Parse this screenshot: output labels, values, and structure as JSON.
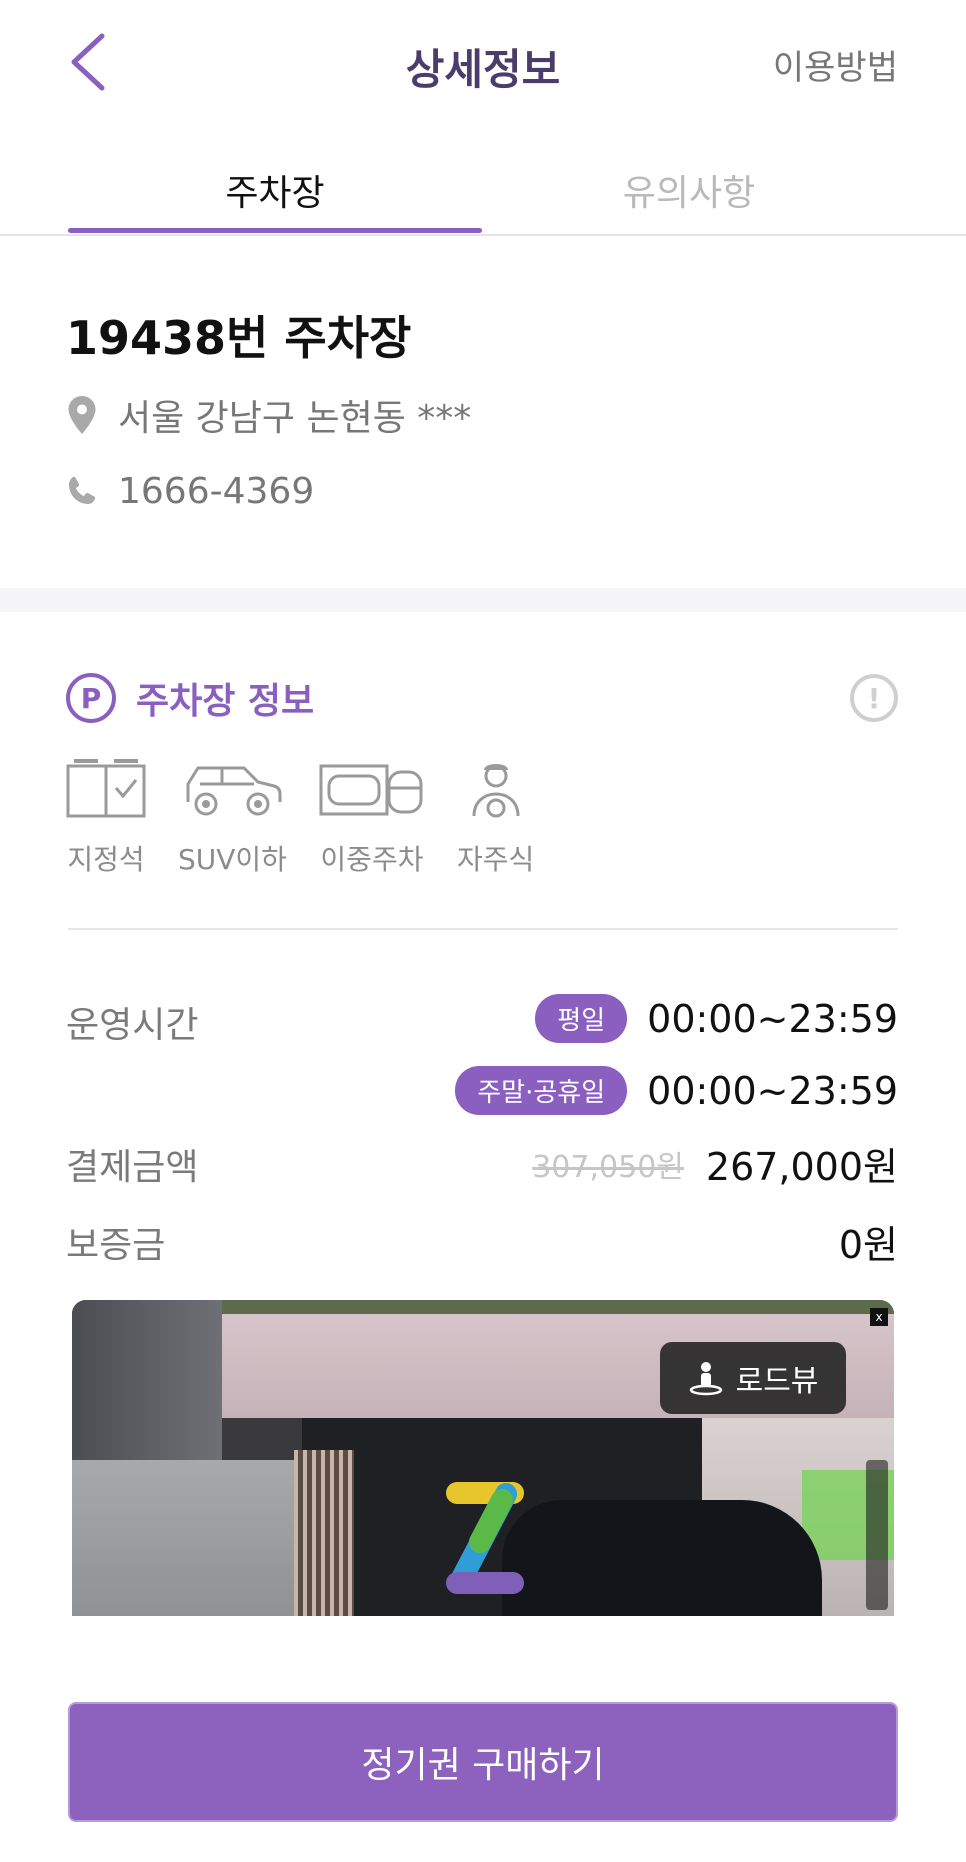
{
  "header": {
    "title": "상세정보",
    "help_label": "이용방법"
  },
  "tabs": [
    {
      "label": "주차장",
      "active": true
    },
    {
      "label": "유의사항",
      "active": false
    }
  ],
  "lot": {
    "name": "19438번 주차장",
    "address": "서울 강남구 논현동 ***",
    "phone": "1666-4369"
  },
  "section": {
    "title": "주차장 정보",
    "p_letter": "P",
    "warn_symbol": "!"
  },
  "features": [
    {
      "label": "지정석",
      "icon": "reserved-seat-icon"
    },
    {
      "label": "SUV이하",
      "icon": "suv-car-icon"
    },
    {
      "label": "이중주차",
      "icon": "double-parking-icon"
    },
    {
      "label": "자주식",
      "icon": "self-parking-icon"
    }
  ],
  "details": {
    "hours_label": "운영시간",
    "weekday_badge": "평일",
    "weekday_hours": "00:00~23:59",
    "weekend_badge": "주말·공휴일",
    "weekend_hours": "00:00~23:59",
    "price_label": "결제금액",
    "original_price": "307,050원",
    "price": "267,000원",
    "deposit_label": "보증금",
    "deposit": "0원"
  },
  "roadview": {
    "button_label": "로드뷰",
    "close_label": "x"
  },
  "cta": {
    "label": "정기권 구매하기"
  },
  "colors": {
    "accent": "#8a5fbf",
    "cta": "#8d62be"
  }
}
